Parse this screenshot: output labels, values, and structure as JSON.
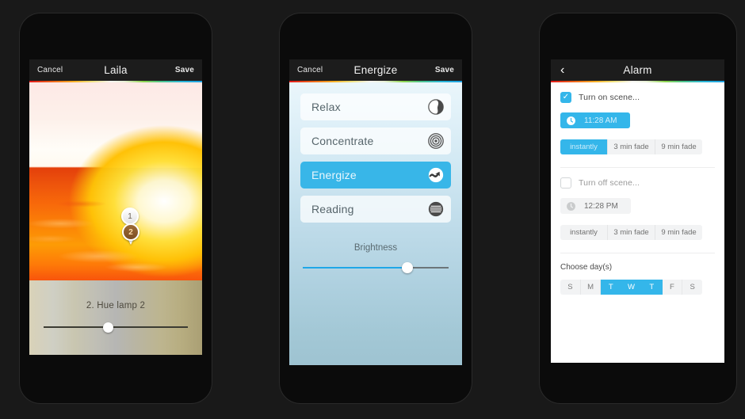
{
  "phone1": {
    "nav": {
      "left": "Cancel",
      "title": "Laila",
      "right": "Save"
    },
    "markers": [
      {
        "label": "1"
      },
      {
        "label": "2"
      }
    ],
    "lamp": {
      "title": "2. Hue lamp 2",
      "slider_value": 45
    },
    "tabs": [
      {
        "icon": "clock-icon",
        "name": "tab-timer"
      },
      {
        "icon": "hourglass-icon",
        "name": "tab-countdown"
      },
      {
        "icon": "navigation-arrow-icon",
        "name": "tab-geofence"
      },
      {
        "icon": "layers-icon",
        "name": "tab-scenes"
      },
      {
        "icon": "bulb-icon",
        "name": "tab-lights"
      }
    ]
  },
  "phone2": {
    "nav": {
      "left": "Cancel",
      "title": "Energize",
      "right": "Save"
    },
    "scenes": [
      {
        "label": "Relax",
        "icon": "yin-yang-icon",
        "selected": false
      },
      {
        "label": "Concentrate",
        "icon": "target-icon",
        "selected": false
      },
      {
        "label": "Energize",
        "icon": "wave-icon",
        "selected": true
      },
      {
        "label": "Reading",
        "icon": "lines-circle-icon",
        "selected": false
      }
    ],
    "brightness": {
      "label": "Brightness",
      "value": 72
    },
    "tabs": [
      {
        "icon": "clock-icon",
        "name": "tab-timer"
      },
      {
        "icon": "hourglass-icon",
        "name": "tab-countdown"
      },
      {
        "icon": "navigation-arrow-icon",
        "name": "tab-geofence"
      },
      {
        "icon": "bulb-icon",
        "name": "tab-lights"
      }
    ]
  },
  "phone3": {
    "nav": {
      "back": "‹",
      "title": "Alarm"
    },
    "turn_on": {
      "checkbox_checked": true,
      "check_glyph": "✓",
      "label": "Turn on scene...",
      "time": "11:28 AM",
      "fade_options": [
        "instantly",
        "3 min fade",
        "9 min fade"
      ],
      "fade_selected": "instantly"
    },
    "turn_off": {
      "checkbox_checked": false,
      "label": "Turn off scene...",
      "time": "12:28 PM",
      "fade_options": [
        "instantly",
        "3 min fade",
        "9 min fade"
      ],
      "fade_selected": null
    },
    "choose_days_label": "Choose day(s)",
    "days": [
      {
        "label": "S",
        "on": false
      },
      {
        "label": "M",
        "on": false
      },
      {
        "label": "T",
        "on": true
      },
      {
        "label": "W",
        "on": true
      },
      {
        "label": "T",
        "on": true
      },
      {
        "label": "F",
        "on": false
      },
      {
        "label": "S",
        "on": false
      }
    ]
  },
  "colors": {
    "accent_blue": "#34b6ea",
    "scene_selected": "#38b6e8",
    "background": "#191919",
    "navbar": "#1c1c1c",
    "marker_two": "#7d4f24"
  }
}
